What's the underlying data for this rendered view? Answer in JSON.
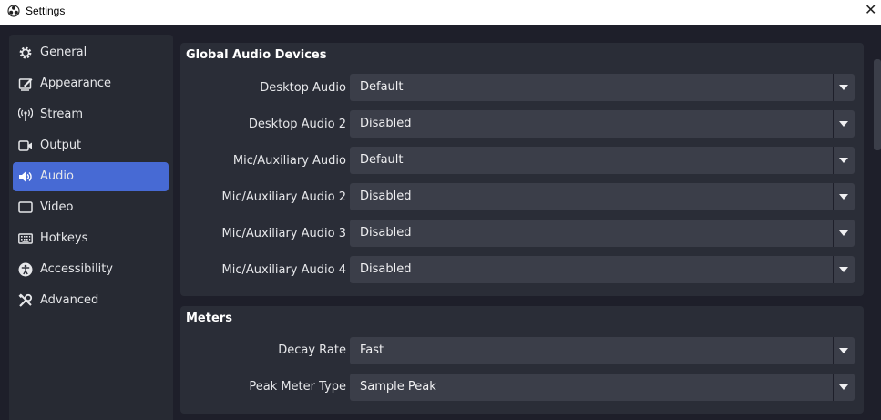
{
  "window": {
    "title": "Settings",
    "close_glyph": "✕"
  },
  "sidebar": {
    "items": [
      {
        "label": "General",
        "icon": "gear-icon"
      },
      {
        "label": "Appearance",
        "icon": "appearance-icon"
      },
      {
        "label": "Stream",
        "icon": "antenna-icon"
      },
      {
        "label": "Output",
        "icon": "video-camera-icon"
      },
      {
        "label": "Audio",
        "icon": "speaker-icon",
        "active": true
      },
      {
        "label": "Video",
        "icon": "monitor-icon"
      },
      {
        "label": "Hotkeys",
        "icon": "keyboard-icon"
      },
      {
        "label": "Accessibility",
        "icon": "accessibility-icon"
      },
      {
        "label": "Advanced",
        "icon": "tools-icon"
      }
    ]
  },
  "global_audio": {
    "title": "Global Audio Devices",
    "rows": [
      {
        "label": "Desktop Audio",
        "value": "Default"
      },
      {
        "label": "Desktop Audio 2",
        "value": "Disabled"
      },
      {
        "label": "Mic/Auxiliary Audio",
        "value": "Default"
      },
      {
        "label": "Mic/Auxiliary Audio 2",
        "value": "Disabled"
      },
      {
        "label": "Mic/Auxiliary Audio 3",
        "value": "Disabled"
      },
      {
        "label": "Mic/Auxiliary Audio 4",
        "value": "Disabled"
      }
    ]
  },
  "meters": {
    "title": "Meters",
    "rows": [
      {
        "label": "Decay Rate",
        "value": "Fast"
      },
      {
        "label": "Peak Meter Type",
        "value": "Sample Peak"
      }
    ]
  },
  "colors": {
    "background": "#1e1f2a",
    "panel": "#272a33",
    "group": "#2a2d37",
    "select": "#3b3e49",
    "accent": "#476ad4",
    "text": "#e6e7ea"
  }
}
